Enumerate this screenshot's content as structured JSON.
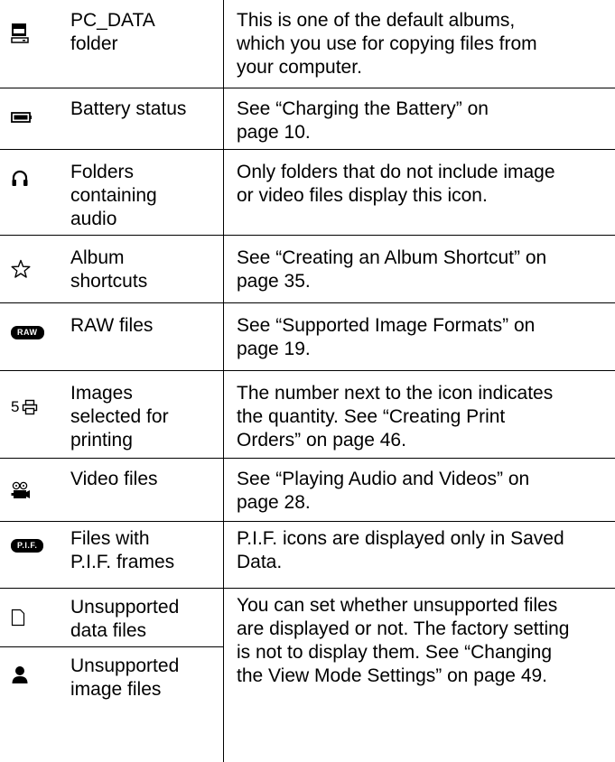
{
  "rows": [
    {
      "icon": "pc-folder-icon",
      "name": "PC_DATA\nfolder",
      "desc": "This is one of the default albums,\nwhich you use for copying files from\nyour computer."
    },
    {
      "icon": "battery-icon",
      "name": "Battery status",
      "desc": "See “Charging the Battery” on\npage 10."
    },
    {
      "icon": "headphones-icon",
      "name": "Folders\ncontaining\naudio",
      "desc": "Only folders that do not include image\nor video files display this icon."
    },
    {
      "icon": "star-icon",
      "name": "Album\nshortcuts",
      "desc": "See “Creating an Album Shortcut” on\npage 35."
    },
    {
      "icon": "raw-icon",
      "icon_text": "RAW",
      "name": "RAW files",
      "desc": "See “Supported Image Formats” on\npage 19."
    },
    {
      "icon": "print-icon",
      "icon_count": "5",
      "name": "Images\nselected for\nprinting",
      "desc": "The number next to the icon indicates\nthe quantity. See “Creating Print\nOrders” on page 46."
    },
    {
      "icon": "video-camera-icon",
      "name": "Video files",
      "desc": "See “Playing Audio and Videos” on\npage 28."
    },
    {
      "icon": "pif-icon",
      "icon_text": "P.I.F.",
      "name": "Files with\nP.I.F. frames",
      "desc": "P.I.F. icons are displayed only in Saved\nData."
    },
    {
      "icon": "blank-page-icon",
      "name": "Unsupported\ndata files"
    },
    {
      "icon": "person-icon",
      "name": "Unsupported\nimage files"
    }
  ],
  "shared_desc": "You can set whether unsupported files\nare displayed or not. The factory setting\nis not to display them. See “Changing\nthe View Mode Settings” on page 49."
}
